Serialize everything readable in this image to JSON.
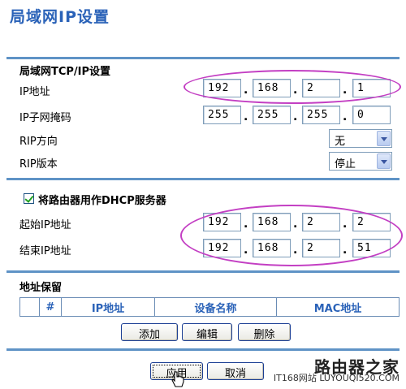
{
  "page": {
    "title": "局域网IP设置"
  },
  "lan": {
    "section_title": "局域网TCP/IP设置",
    "ip_label": "IP地址",
    "ip": [
      "192",
      "168",
      "2",
      "1"
    ],
    "mask_label": "IP子网掩码",
    "mask": [
      "255",
      "255",
      "255",
      "0"
    ],
    "rip_dir_label": "RIP方向",
    "rip_dir_value": "无",
    "rip_ver_label": "RIP版本",
    "rip_ver_value": "停止"
  },
  "dhcp": {
    "enable_label": "将路由器用作DHCP服务器",
    "enabled": true,
    "start_label": "起始IP地址",
    "start_ip": [
      "192",
      "168",
      "2",
      "2"
    ],
    "end_label": "结束IP地址",
    "end_ip": [
      "192",
      "168",
      "2",
      "51"
    ]
  },
  "reservation": {
    "section_title": "地址保留",
    "columns": [
      "",
      "#",
      "IP地址",
      "设备名称",
      "MAC地址"
    ],
    "add_label": "添加",
    "edit_label": "编辑",
    "delete_label": "删除"
  },
  "footer": {
    "apply_label": "应用",
    "cancel_label": "取消"
  },
  "watermark": {
    "brand": "路由器之家",
    "site": "IT168网站 LUYOUQI520.COM"
  },
  "colors": {
    "title": "#2a62b8",
    "rule": "#5f93c6",
    "highlight_ellipse": "#c33fc3"
  }
}
